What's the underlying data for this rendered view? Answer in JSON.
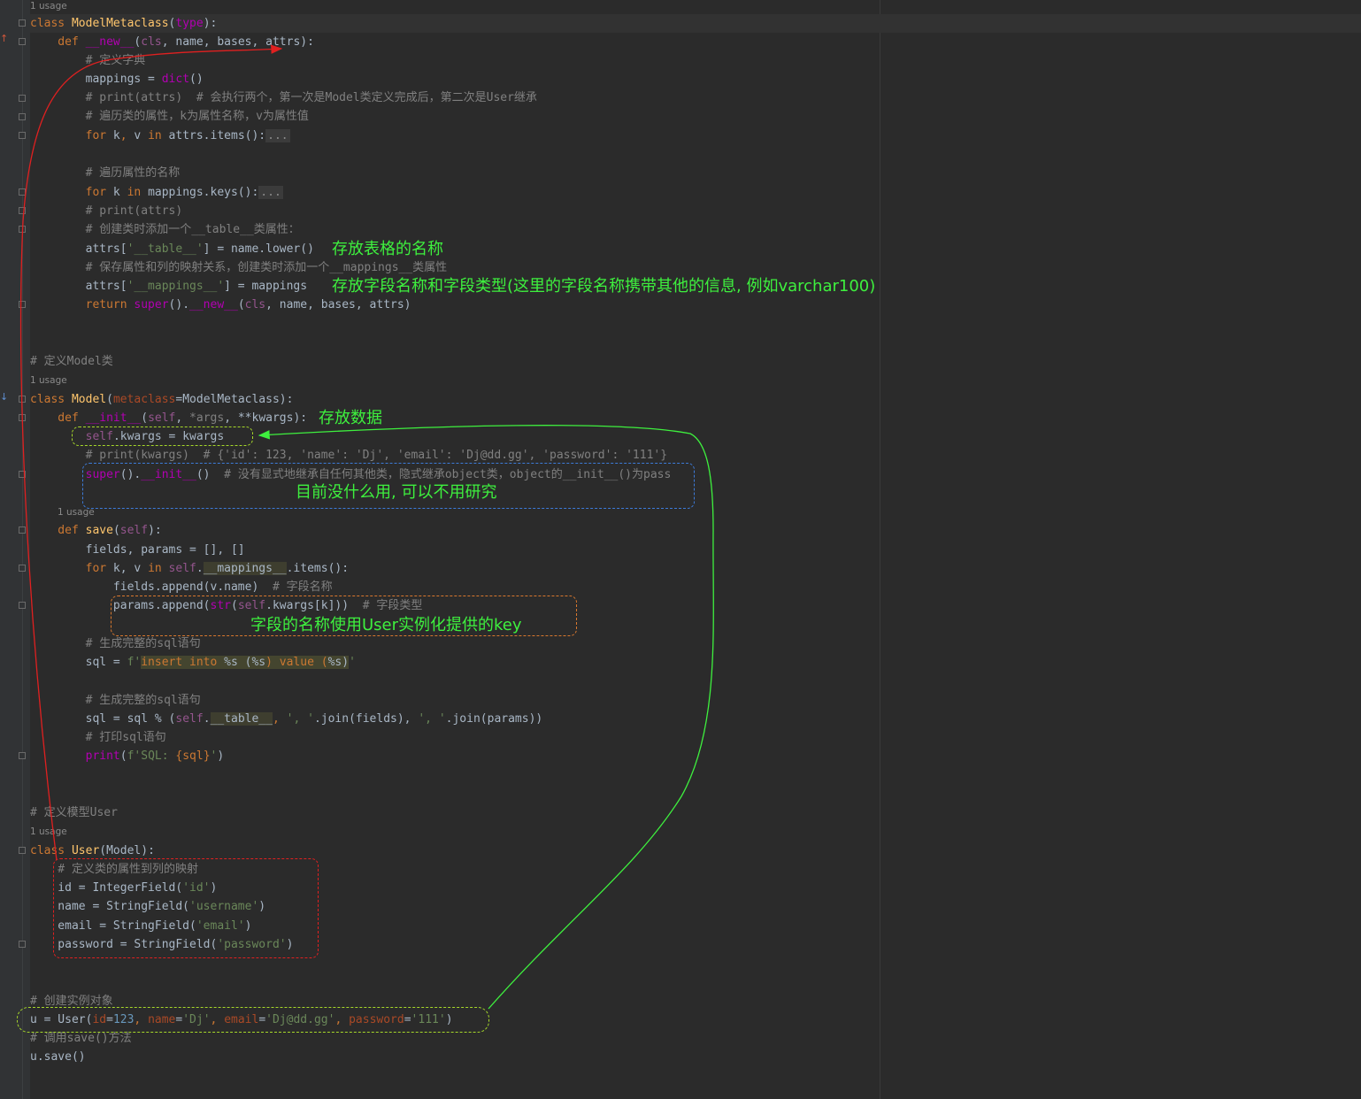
{
  "editor": {
    "lines": {
      "l0": [
        "class ",
        "ModelMetaclass",
        "(",
        "type",
        "):"
      ],
      "l1": [
        "    def ",
        "__new__",
        "(",
        "cls",
        ", name, bases, attrs):"
      ],
      "l2": [
        "        # 定义字典"
      ],
      "l3": [
        "        mappings = ",
        "dict",
        "()"
      ],
      "l4": [
        "        # print(attrs)  # 会执行两个，第一次是Model类定义完成后，第二次是User继承"
      ],
      "l5": [
        "        # 遍历类的属性，k为属性名称，v为属性值"
      ],
      "l6": [
        "        for ",
        "k",
        ", ",
        "v ",
        "in ",
        "attrs.items():",
        "..."
      ],
      "l7": [
        "        # 遍历属性的名称"
      ],
      "l8": [
        "        for ",
        "k ",
        "in ",
        "mappings.keys():",
        "..."
      ],
      "l9": [
        "        # print(attrs)"
      ],
      "l10": [
        "        # 创建类时添加一个__table__类属性："
      ],
      "l11": [
        "        attrs[",
        "'__table__'",
        "] = name.lower()"
      ],
      "l12": [
        "        # 保存属性和列的映射关系，创建类时添加一个__mappings__类属性"
      ],
      "l13": [
        "        attrs[",
        "'__mappings__'",
        "] = mappings"
      ],
      "l14": [
        "        return ",
        "super",
        "().",
        "__new__",
        "(",
        "cls",
        ", name, bases, attrs)"
      ],
      "l15": [
        "# 定义Model类"
      ],
      "l16": [
        "class ",
        "Model",
        "(",
        "metaclass",
        "=ModelMetaclass):"
      ],
      "l17": [
        "    def ",
        "__init__",
        "(",
        "self",
        ", ",
        "*args",
        ", **kwargs):"
      ],
      "l18": [
        "        ",
        "self",
        ".kwargs = kwargs"
      ],
      "l19": [
        "        # print(kwargs)  # {'id': 123, 'name': 'Dj', 'email': 'Dj@dd.gg', 'password': '111'}"
      ],
      "l20": [
        "        super",
        "().",
        "__init__",
        "()  ",
        "# 没有显式地继承自任何其他类，隐式继承object类，object的__init__()为pass"
      ],
      "l21": [
        "    def ",
        "save",
        "(",
        "self",
        "):"
      ],
      "l22": [
        "        fields, params = [], []"
      ],
      "l23": [
        "        for ",
        "k, v ",
        "in ",
        "self",
        ".",
        "__mappings__",
        ".items():"
      ],
      "l24": [
        "            fields.append(v.name)  ",
        "# 字段名称"
      ],
      "l25": [
        "            params.append(",
        "str",
        "(",
        "self",
        ".kwargs[k]))  ",
        "# 字段类型"
      ],
      "l26": [
        "        # 生成完整的sql语句"
      ],
      "l27": [
        "        sql = ",
        "f'",
        "insert into ",
        "%s",
        " (",
        "%s",
        ") value (",
        "%s",
        ")",
        "'"
      ],
      "l28": [
        "        # 生成完整的sql语句"
      ],
      "l29": [
        "        sql = sql % (",
        "self",
        ".",
        "__table__",
        ", ",
        "', '",
        ".join(fields), ",
        "', '",
        ".join(params))"
      ],
      "l30": [
        "        # 打印sql语句"
      ],
      "l31": [
        "        ",
        "print",
        "(",
        "f'SQL: ",
        "{sql}",
        "'",
        ")"
      ],
      "l32": [
        "# 定义模型User"
      ],
      "l33": [
        "class ",
        "User",
        "(Model):"
      ],
      "l34": [
        "    # 定义类的属性到列的映射"
      ],
      "l35": [
        "    id = IntegerField(",
        "'id'",
        ")"
      ],
      "l36": [
        "    name = StringField(",
        "'username'",
        ")"
      ],
      "l37": [
        "    email = StringField(",
        "'email'",
        ")"
      ],
      "l38": [
        "    password = StringField(",
        "'password'",
        ")"
      ],
      "l39": [
        "# 创建实例对象"
      ],
      "l40": [
        "u = User(",
        "id",
        "=",
        "123",
        ", ",
        "name",
        "=",
        "'Dj'",
        ", ",
        "email",
        "=",
        "'Dj@dd.gg'",
        ", ",
        "password",
        "=",
        "'111'",
        ")"
      ],
      "l41": [
        "# 调用save()方法"
      ],
      "l42": [
        "u.save()"
      ]
    },
    "usage_hints": [
      "1 usage",
      "1 usage",
      "1 usage",
      "1 usage"
    ]
  },
  "annotations": {
    "table_name": "存放表格的名称",
    "mappings_desc": "存放字段名称和字段类型(这里的字段名称携带其他的信息, 例如varchar100)",
    "store_data": "存放数据",
    "unused": "目前没什么用, 可以不用研究",
    "field_key": "字段的名称使用User实例化提供的key"
  },
  "colors": {
    "keyword": "#cc7832",
    "function": "#ffc66d",
    "comment": "#808080",
    "string": "#6a8759",
    "number": "#6897bb",
    "self": "#94558d",
    "annotation_green": "#3ef03e",
    "arrow_red": "#e02020",
    "box_blue": "#3d7bd9",
    "box_orange": "#d9782e",
    "box_yellowgreen": "#a6d82a"
  }
}
